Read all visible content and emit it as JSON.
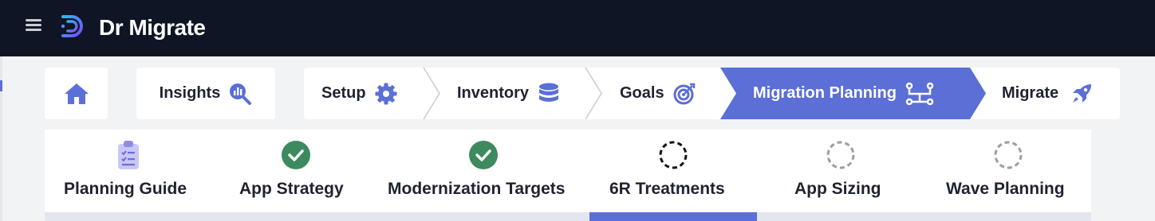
{
  "app": {
    "title": "Dr Migrate",
    "menu_icon": "hamburger-menu-icon",
    "logo_icon": "dr-migrate-logo-icon",
    "colors": {
      "topbar": "#0f1524",
      "accent": "#5b6fd6",
      "success": "#3d8a5f",
      "text": "#1f2330"
    }
  },
  "nav": {
    "home_icon": "home-icon",
    "insights": {
      "label": "Insights",
      "icon": "analytics-search-icon"
    },
    "breadcrumbs": [
      {
        "label": "Setup",
        "icon": "gear-icon",
        "active": false
      },
      {
        "label": "Inventory",
        "icon": "database-icon",
        "active": false
      },
      {
        "label": "Goals",
        "icon": "target-icon",
        "active": false
      },
      {
        "label": "Migration Planning",
        "icon": "network-nodes-icon",
        "active": true
      },
      {
        "label": "Migrate",
        "icon": "rocket-icon",
        "active": false
      }
    ]
  },
  "subtabs": [
    {
      "label": "Planning Guide",
      "icon": "clipboard-checklist-icon",
      "status": "guide"
    },
    {
      "label": "App Strategy",
      "icon": "check-circle-icon",
      "status": "complete"
    },
    {
      "label": "Modernization Targets",
      "icon": "check-circle-icon",
      "status": "complete"
    },
    {
      "label": "6R Treatments",
      "icon": "dashed-circle-icon",
      "status": "current",
      "selected": true
    },
    {
      "label": "App Sizing",
      "icon": "dashed-circle-icon",
      "status": "pending"
    },
    {
      "label": "Wave Planning",
      "icon": "dashed-circle-icon",
      "status": "pending"
    }
  ]
}
